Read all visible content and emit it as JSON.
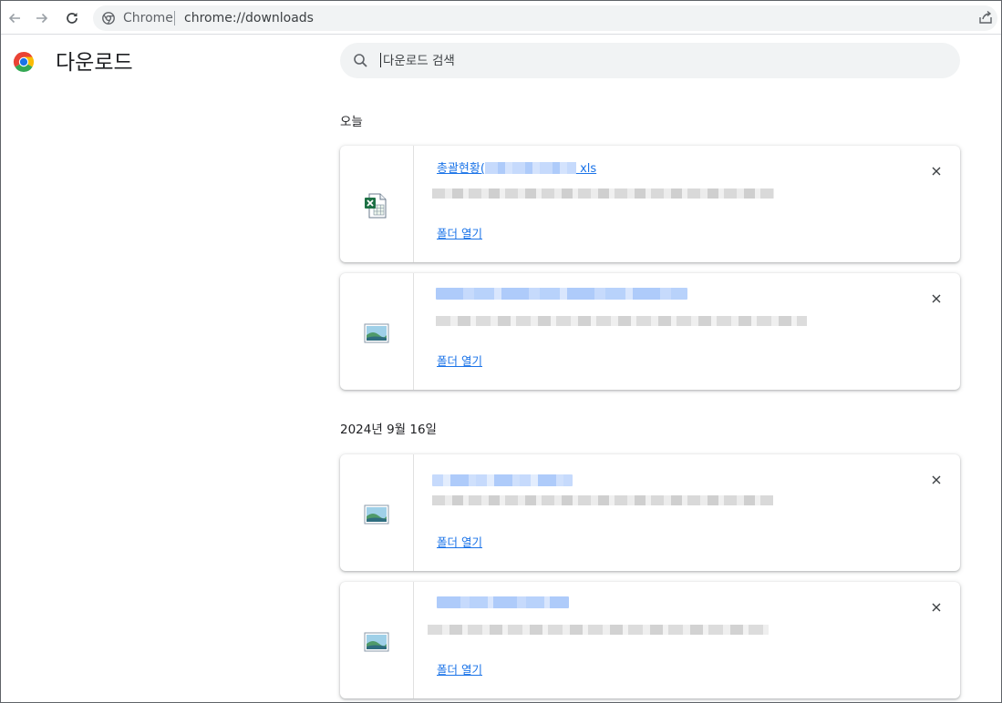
{
  "toolbar": {
    "site_chip": "Chrome",
    "url": "chrome://downloads",
    "icons": [
      "back-arrow-icon",
      "forward-arrow-icon",
      "reload-icon",
      "chrome-site-icon",
      "share-icon"
    ]
  },
  "page": {
    "title": "다운로드",
    "search_placeholder": "다운로드 검색"
  },
  "groups": [
    {
      "date": "오늘",
      "items": [
        {
          "name_prefix": "총괄현황(",
          "name_suffix": "xls",
          "type": "excel",
          "open_folder": "폴더 열기"
        },
        {
          "name_prefix": "",
          "name_suffix": "",
          "type": "image",
          "open_folder": "폴더 열기"
        }
      ]
    },
    {
      "date": "2024년 9월 16일",
      "items": [
        {
          "name_prefix": "",
          "name_suffix": "",
          "type": "image",
          "open_folder": "폴더 열기"
        },
        {
          "name_prefix": "",
          "name_suffix": "",
          "type": "image",
          "open_folder": "폴더 열기"
        }
      ]
    }
  ],
  "colors": {
    "link": "#1a73e8",
    "omnibox_bg": "#f1f3f4",
    "redacted_name": "#aecbfa",
    "redacted_meta": "#d6d6d6"
  }
}
